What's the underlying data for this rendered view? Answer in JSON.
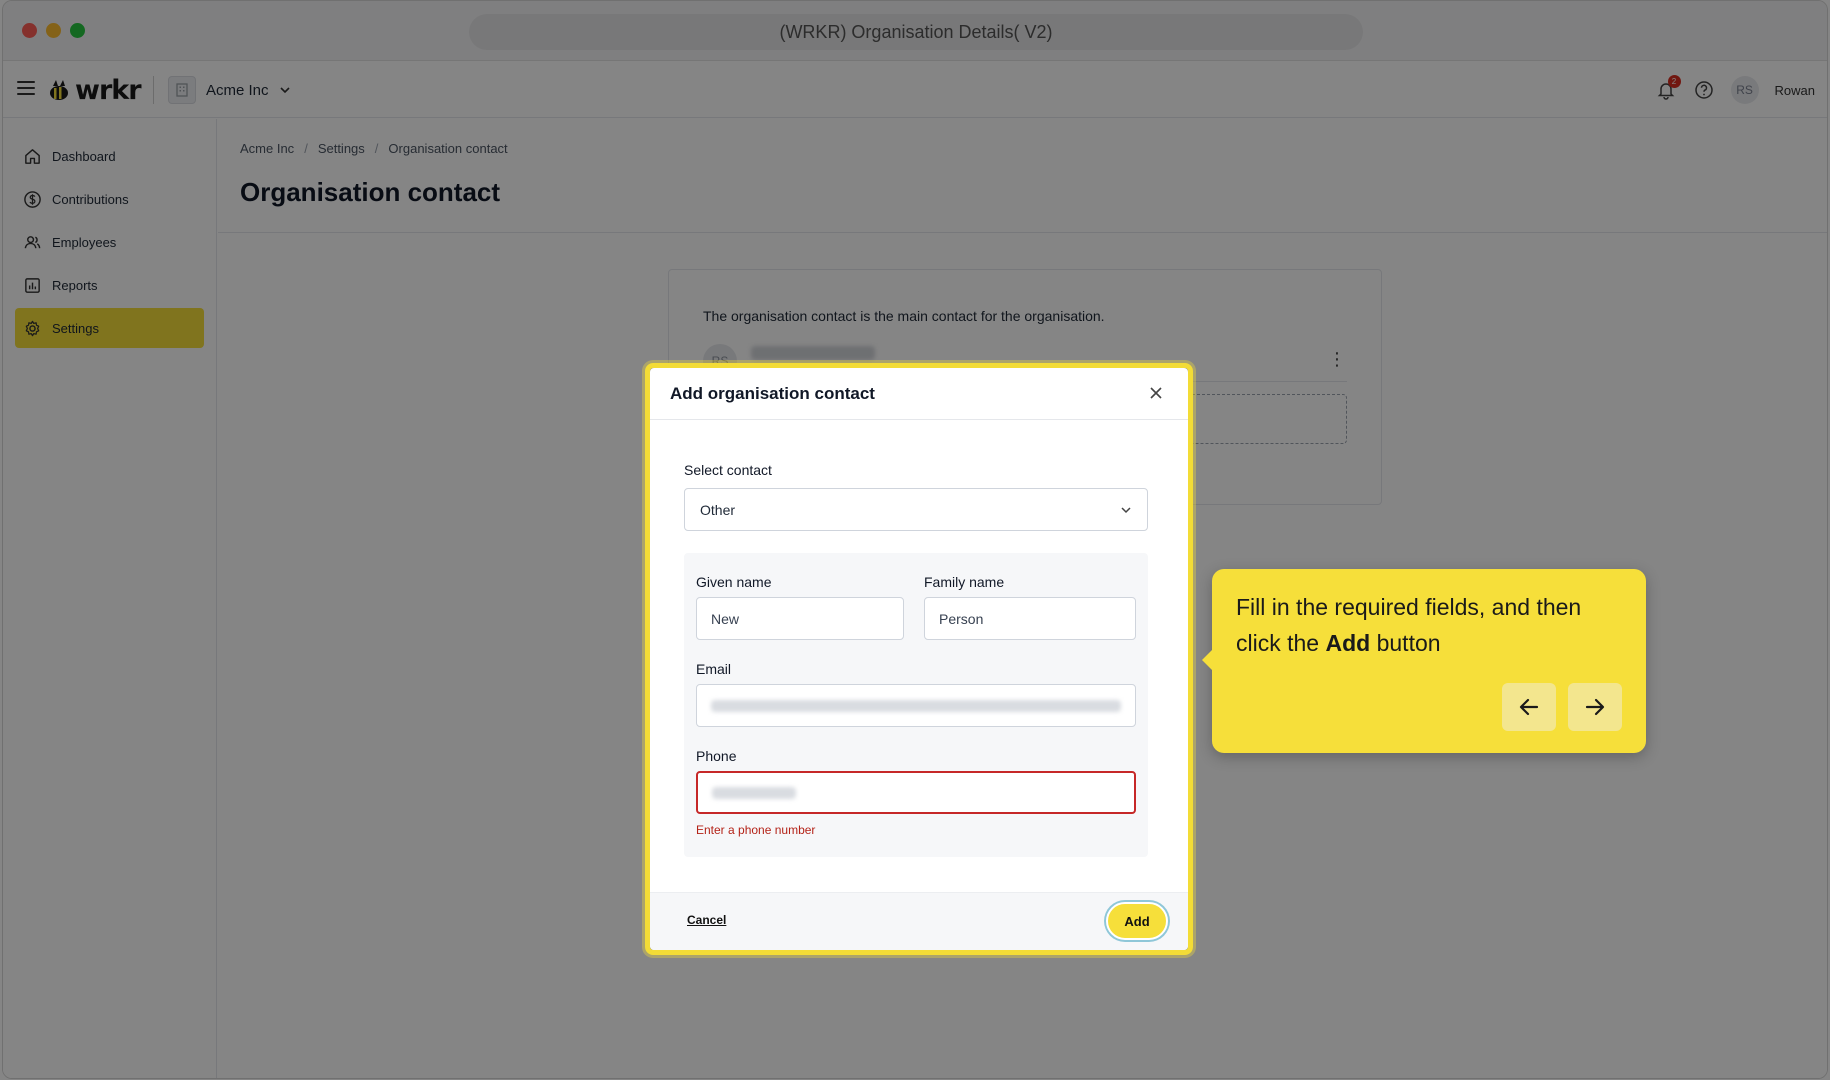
{
  "browser": {
    "title": "(WRKR) Organisation Details( V2)"
  },
  "topbar": {
    "brand": "wrkr",
    "org_name": "Acme Inc",
    "notifications_badge": "2",
    "user_initials": "RS",
    "user_name": "Rowan"
  },
  "sidebar": {
    "items": [
      {
        "label": "Dashboard",
        "icon": "home-icon",
        "active": false
      },
      {
        "label": "Contributions",
        "icon": "dollar-circle-icon",
        "active": false
      },
      {
        "label": "Employees",
        "icon": "users-icon",
        "active": false
      },
      {
        "label": "Reports",
        "icon": "bar-chart-icon",
        "active": false
      },
      {
        "label": "Settings",
        "icon": "gear-icon",
        "active": true
      }
    ]
  },
  "breadcrumb": [
    "Acme Inc",
    "Settings",
    "Organisation contact"
  ],
  "page": {
    "title": "Organisation contact",
    "description": "The organisation contact is the main contact for the organisation.",
    "contact_initials": "RS"
  },
  "modal": {
    "title": "Add organisation contact",
    "select_label": "Select contact",
    "select_value": "Other",
    "given_name_label": "Given name",
    "given_name_value": "New",
    "family_name_label": "Family name",
    "family_name_value": "Person",
    "email_label": "Email",
    "phone_label": "Phone",
    "phone_error": "Enter a phone number",
    "cancel_label": "Cancel",
    "add_label": "Add"
  },
  "tooltip": {
    "text_before": "Fill in the required fields, and then click the ",
    "text_bold": "Add",
    "text_after": " button"
  },
  "colors": {
    "accent": "#f6df3a",
    "error": "#c62828"
  }
}
